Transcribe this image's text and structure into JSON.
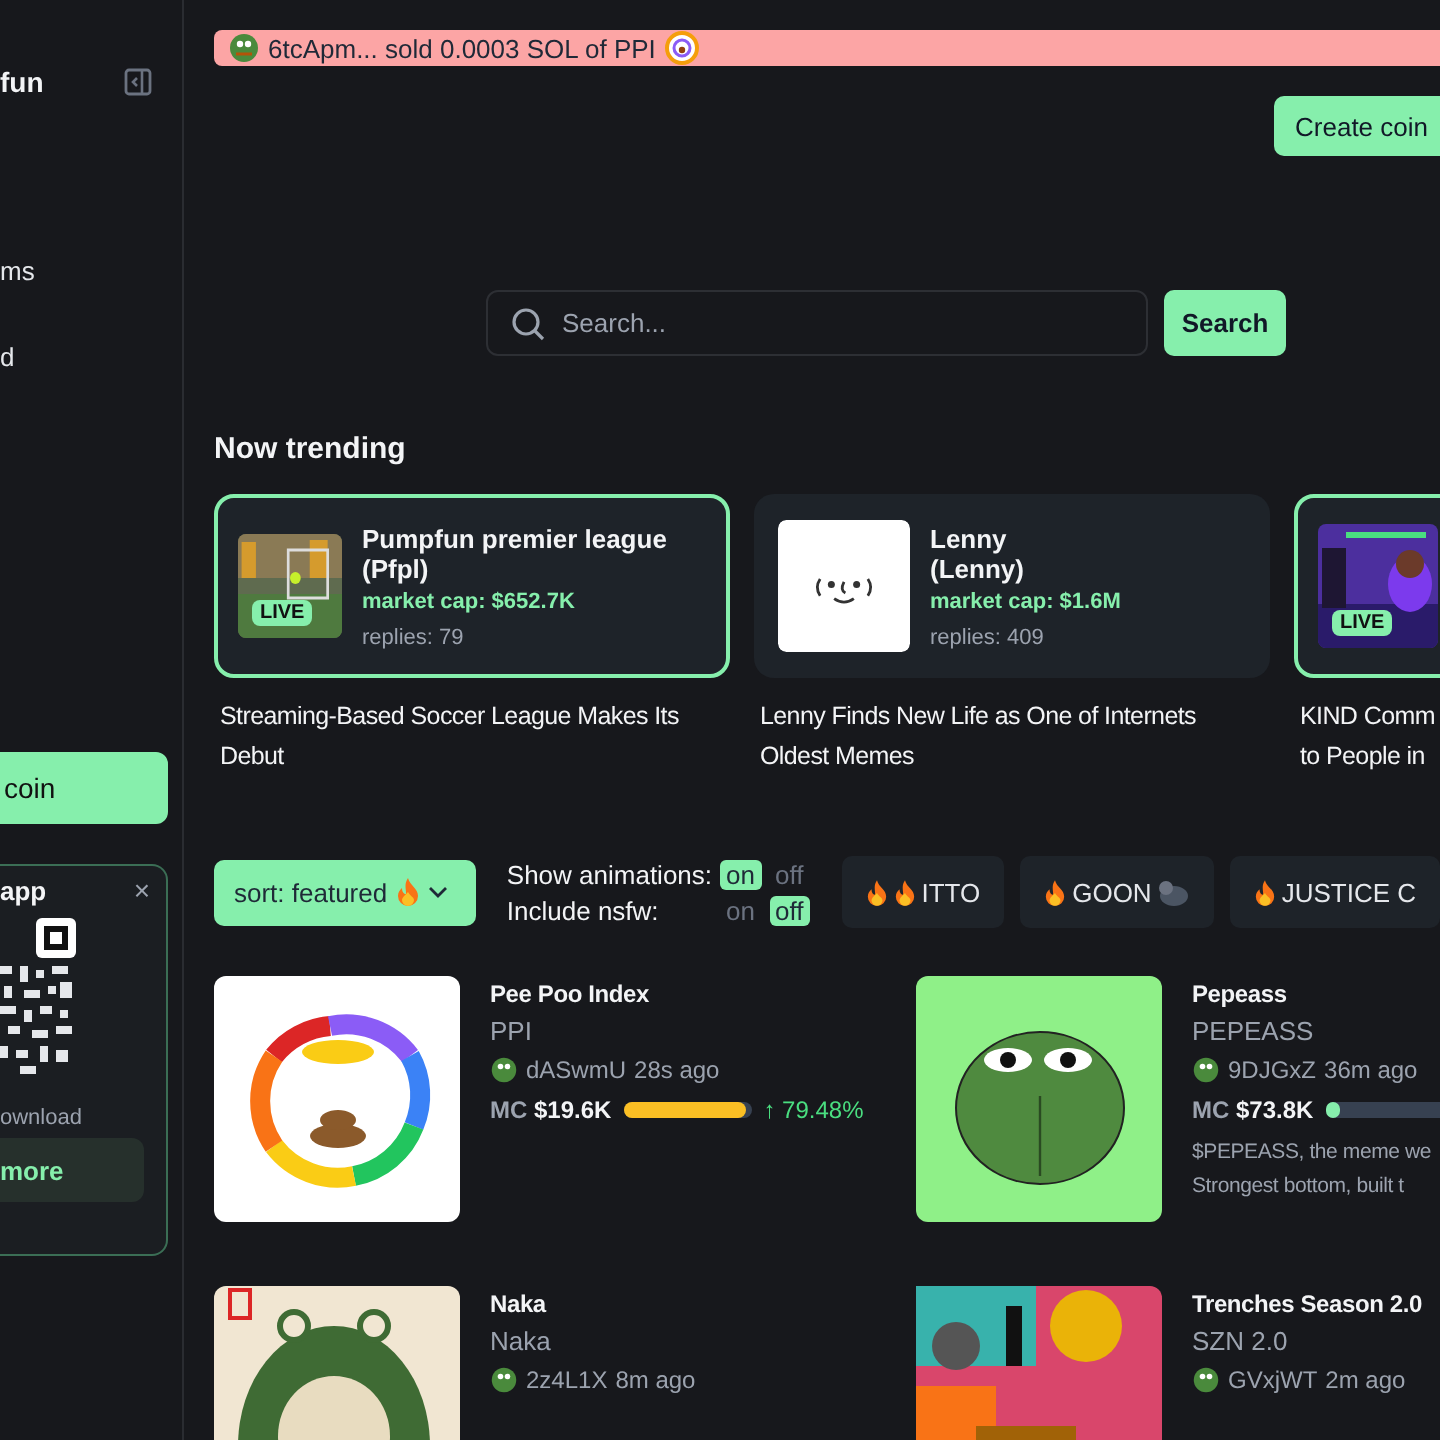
{
  "sidebar": {
    "logo": "fun",
    "items": [
      {
        "label": "ms"
      },
      {
        "label": "d"
      }
    ],
    "create_button": "coin",
    "app_card": {
      "title": "app",
      "close": "×",
      "caption": "ownload",
      "more_button": "more"
    }
  },
  "ticker": {
    "text": "6tcApm... sold 0.0003 SOL of PPI"
  },
  "create_coin": "Create coin",
  "search": {
    "placeholder": "Search...",
    "button": "Search"
  },
  "trending": {
    "title": "Now trending",
    "cards": [
      {
        "kind": "soccer",
        "badge": "LIVE",
        "highlighted": true,
        "name": "Pumpfun premier league",
        "ticker": "(Pfpl)",
        "market_cap": "market cap: $652.7K",
        "replies": "replies: 79",
        "headline_lines": [
          "Streaming-Based Soccer League Makes Its",
          "Debut"
        ]
      },
      {
        "kind": "lenny",
        "highlighted": false,
        "name": "Lenny",
        "ticker": "(Lenny)",
        "market_cap": "market cap: $1.6M",
        "replies": "replies: 409",
        "headline_lines": [
          "Lenny Finds New Life as One of Internets",
          "Oldest Memes"
        ]
      },
      {
        "kind": "stream",
        "badge": "LIVE",
        "highlighted": true,
        "headline_lines": [
          "KIND Comm",
          "to People in"
        ]
      }
    ]
  },
  "sort": {
    "label": "sort: featured"
  },
  "toggles": [
    {
      "label": "Show animations:",
      "options": [
        {
          "label": "on",
          "selected": true
        },
        {
          "label": "off",
          "selected": false
        }
      ]
    },
    {
      "label": "Include nsfw:",
      "options": [
        {
          "label": "on",
          "selected": false
        },
        {
          "label": "off",
          "selected": true
        }
      ]
    }
  ],
  "chips": [
    {
      "kind": "double_flame",
      "label": "ITTO"
    },
    {
      "kind": "flame_gorilla",
      "label": "GOON"
    },
    {
      "kind": "flame",
      "label": "JUSTICE C"
    }
  ],
  "coins": [
    {
      "kind": "ring",
      "name": "Pee Poo Index",
      "ticker": "PPI",
      "creator": "dASwmU",
      "age": "28s ago",
      "mc_label": "MC",
      "mc": "$19.6K",
      "level": 0.95,
      "change": "↑ 79.48%"
    },
    {
      "kind": "frog",
      "name": "Pepeass",
      "ticker": "PEPEASS",
      "creator": "9DJGxZ",
      "age": "36m ago",
      "mc_label": "MC",
      "mc": "$73.8K",
      "level": 0.12,
      "description_lines": [
        "$PEPEASS, the meme we",
        "Strongest bottom, built t"
      ]
    },
    {
      "kind": "naka",
      "name": "Naka",
      "ticker": "Naka",
      "creator": "2z4L1X",
      "age": "8m ago"
    },
    {
      "kind": "collage",
      "name": "Trenches Season 2.0",
      "ticker": "SZN 2.0",
      "creator": "GVxjWT",
      "age": "2m ago"
    }
  ]
}
